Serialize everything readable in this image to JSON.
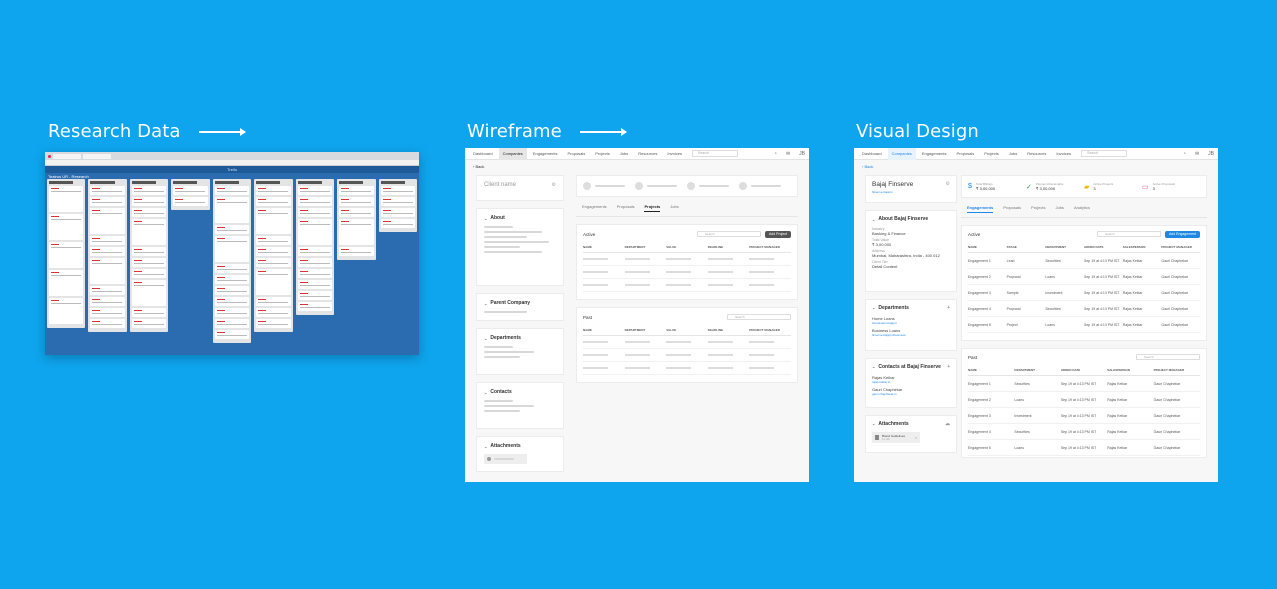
{
  "headings": {
    "research": "Research Data",
    "wireframe": "Wireframe",
    "visual": "Visual Design"
  },
  "colors": {
    "background": "#0ea5ee",
    "accent": "#1e88e5",
    "trello": "#2b6cb0"
  },
  "research_board": {
    "app_label": "Trello",
    "board_title": "Teatrus UR - Research"
  },
  "nav": {
    "items": [
      "Dashboard",
      "Companies",
      "Engagements",
      "Proposals",
      "Projects",
      "Jobs",
      "Resources",
      "Invoices"
    ],
    "active": "Companies",
    "search_placeholder": "Search",
    "user": "JB"
  },
  "back_label": "Back",
  "wireframe": {
    "client_name": "Client name",
    "sections": [
      "About",
      "Parent Company",
      "Departments",
      "Contacts",
      "Attachments"
    ],
    "tabs": [
      "Engagements",
      "Proposals",
      "Projects",
      "Jobs"
    ],
    "active_tab": "Projects",
    "active_table": {
      "title": "Active",
      "search": "Search",
      "button": "Add Project",
      "columns": [
        "NAME",
        "DEPARTMENT",
        "VALUE",
        "DEADLINE",
        "PROJECT MANAGER"
      ]
    },
    "past_table": {
      "title": "Past",
      "search": "Search",
      "columns": [
        "NAME",
        "DEPARTMENT",
        "VALUE",
        "DEADLINE",
        "PROJECT MANAGER"
      ]
    }
  },
  "visual": {
    "client_name": "Bajaj Finserve",
    "client_link": "finserve.bajaj.in",
    "about": {
      "title": "About Bajaj Finserve",
      "industry_label": "Industry",
      "industry": "Banking & Finance",
      "total_value_label": "Total Value",
      "total_value": "₹ 3,00,000",
      "address_label": "Address",
      "address": "Mumbai, Maharashtra, India - 400 012",
      "client_tier_label": "Client Tier",
      "client_tier": "Detail Content"
    },
    "departments": {
      "title": "Departments",
      "items": [
        {
          "name": "Home Loans",
          "link": "homeloans.bajaj.in"
        },
        {
          "name": "Business Loans",
          "link": "finserve.bajaj.in/business"
        }
      ]
    },
    "contacts": {
      "title": "Contacts at Bajaj Finserve",
      "items": [
        {
          "name": "Rajas Kelkar",
          "link": "rajas.kelkar.in"
        },
        {
          "name": "Gauri Chaphekar",
          "link": "gauri.chaphekar.in"
        }
      ]
    },
    "attachments": {
      "title": "Attachments",
      "file": "Brand Guidelines",
      "size": "1.1 mb"
    },
    "stats": [
      {
        "label": "Total Billings",
        "value": "₹ 3,00,000"
      },
      {
        "label": "Payment Receivable",
        "value": "₹ 3,00,000"
      },
      {
        "label": "Active Projects",
        "value": "3"
      },
      {
        "label": "Active Proposals",
        "value": "3"
      }
    ],
    "tabs": [
      "Engagements",
      "Proposals",
      "Projects",
      "Jobs",
      "Analytics"
    ],
    "active_tab": "Engagements",
    "active_table": {
      "title": "Active",
      "search": "Search",
      "button": "Add Engagement",
      "columns": [
        "NAME",
        "STAGE",
        "DEPARTMENT",
        "ADDED DATE",
        "SALESPERSON",
        "PROJECT MANAGER"
      ],
      "rows": [
        [
          "Engagement 1",
          "Lead",
          "Securities",
          "Sep 19 at 4:13 PM IST",
          "Rajas Kelkar",
          "Gauri Chaphekar"
        ],
        [
          "Engagement 2",
          "Proposal",
          "Loans",
          "Sep 19 at 4:13 PM IST",
          "Rajas Kelkar",
          "Gauri Chaphekar"
        ],
        [
          "Engagement 3",
          "Sample",
          "Investment",
          "Sep 19 at 4:13 PM IST",
          "Rajas Kelkar",
          "Gauri Chaphekar"
        ],
        [
          "Engagement 4",
          "Proposal",
          "Securities",
          "Sep 19 at 4:13 PM IST",
          "Rajas Kelkar",
          "Gauri Chaphekar"
        ],
        [
          "Engagement 5",
          "Project",
          "Loans",
          "Sep 19 at 4:13 PM IST",
          "Rajas Kelkar",
          "Gauri Chaphekar"
        ]
      ]
    },
    "past_table": {
      "title": "Past",
      "search": "Search",
      "columns": [
        "NAME",
        "DEPARTMENT",
        "ADDED DATE",
        "SALESPERSON",
        "PROJECT MANAGER"
      ],
      "rows": [
        [
          "Engagement 1",
          "Securities",
          "Sep 19 at 4:13 PM IST",
          "Rajas Kelkar",
          "Gauri Chaphekar"
        ],
        [
          "Engagement 2",
          "Loans",
          "Sep 19 at 4:13 PM IST",
          "Rajas Kelkar",
          "Gauri Chaphekar"
        ],
        [
          "Engagement 3",
          "Investment",
          "Sep 19 at 4:13 PM IST",
          "Rajas Kelkar",
          "Gauri Chaphekar"
        ],
        [
          "Engagement 4",
          "Securities",
          "Sep 19 at 4:13 PM IST",
          "Rajas Kelkar",
          "Gauri Chaphekar"
        ],
        [
          "Engagement 5",
          "Loans",
          "Sep 19 at 4:13 PM IST",
          "Rajas Kelkar",
          "Gauri Chaphekar"
        ]
      ]
    }
  }
}
